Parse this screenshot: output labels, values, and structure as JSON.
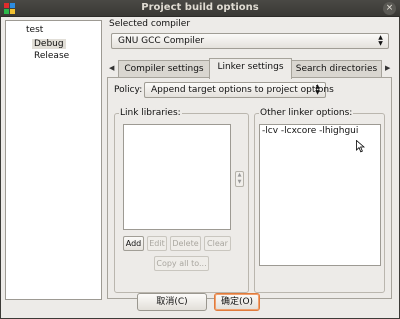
{
  "window": {
    "title": "Project build options",
    "close_glyph": "×"
  },
  "tree": {
    "root": "test",
    "items": [
      "Debug",
      "Release"
    ],
    "selected": "Debug"
  },
  "compiler": {
    "label": "Selected compiler",
    "value": "GNU GCC Compiler"
  },
  "tabs": {
    "items": [
      "Compiler settings",
      "Linker settings",
      "Search directories"
    ],
    "active": "Linker settings",
    "scroll_left": "◀",
    "scroll_right": "▶"
  },
  "policy": {
    "label": "Policy:",
    "value": "Append target options to project options"
  },
  "link_libraries": {
    "title": "Link libraries:",
    "buttons": {
      "add": "Add",
      "edit": "Edit",
      "delete": "Delete",
      "clear": "Clear",
      "copy_all": "Copy all to..."
    }
  },
  "other_linker": {
    "title": "Other linker options:",
    "value": "-lcv -lcxcore -lhighgui"
  },
  "dialog_buttons": {
    "cancel": "取消(C)",
    "ok": "确定(O)"
  },
  "icons": [
    "app-icon",
    "close-icon",
    "combo-arrow-icon",
    "tab-scroll-left-icon",
    "tab-scroll-right-icon",
    "spin-icon",
    "mouse-cursor-icon"
  ]
}
